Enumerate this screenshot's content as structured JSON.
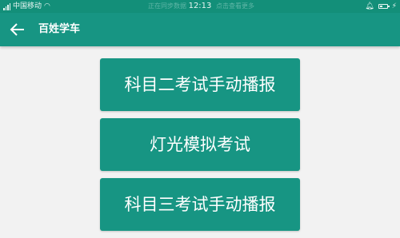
{
  "status_bar": {
    "carrier": "中国移动",
    "time": "12:13",
    "center_left_faint": "正在同步数据",
    "center_right_faint": "点击查看更多",
    "icons": [
      "signal-icon",
      "wifi-icon",
      "bell-icon",
      "battery-icon",
      "bolt-icon"
    ]
  },
  "app_bar": {
    "title": "百姓学车",
    "back_icon": "arrow-left-icon",
    "background_color": "#179583"
  },
  "menu": {
    "items": [
      {
        "label": "科目二考试手动播报"
      },
      {
        "label": "灯光模拟考试"
      },
      {
        "label": "科目三考试手动播报"
      }
    ],
    "button_color": "#179583",
    "text_color": "#ffffff"
  },
  "page": {
    "background_color": "#f2f2f2"
  }
}
